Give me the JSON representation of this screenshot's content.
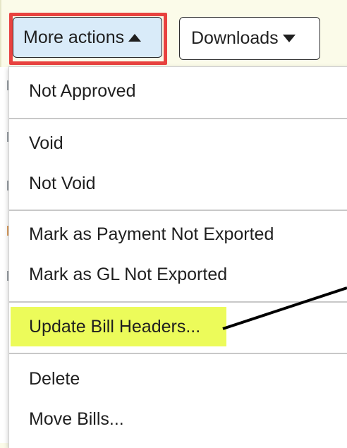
{
  "toolbar": {
    "more_actions_label": "More actions",
    "downloads_label": "Downloads"
  },
  "menu": {
    "items": [
      "Not Approved",
      "Void",
      "Not Void",
      "Mark as Payment Not Exported",
      "Mark as GL Not Exported",
      "Update Bill Headers...",
      "Delete",
      "Move Bills..."
    ]
  },
  "colors": {
    "highlight_border": "#e8423f",
    "highlight_fill": "#ecfb5a",
    "active_button": "#d9ebf9",
    "annotation_arrow": "#000000"
  },
  "icons": {
    "more_actions_caret": "caret-up-icon",
    "downloads_caret": "caret-down-icon"
  }
}
